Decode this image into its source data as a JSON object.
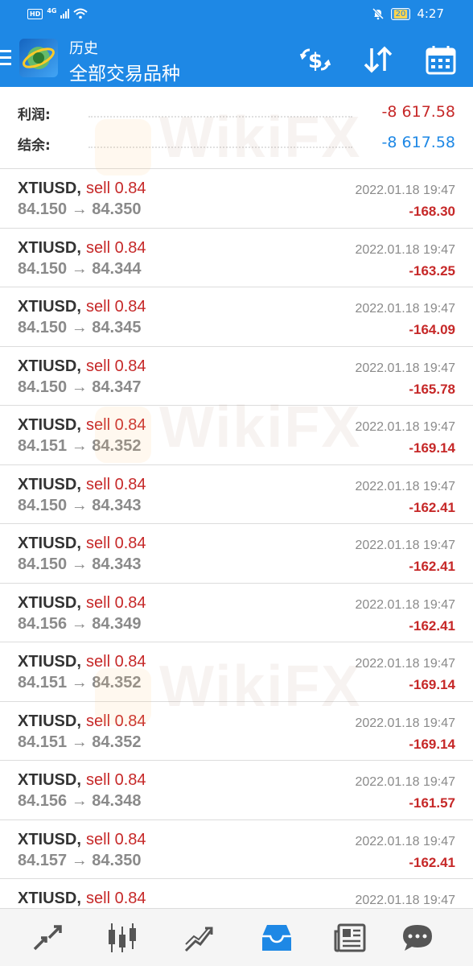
{
  "status_bar": {
    "hd": "HD",
    "network": "4G",
    "battery": "20",
    "time": "4:27"
  },
  "app_bar": {
    "title": "历史",
    "subtitle": "全部交易品种"
  },
  "summary": {
    "profit_label": "利润:",
    "profit_value": "-8 617.58",
    "balance_label": "结余:",
    "balance_value": "-8 617.58"
  },
  "trades": [
    {
      "symbol": "XTIUSD,",
      "side": "sell 0.84",
      "prices": "84.150 → 84.350",
      "time": "2022.01.18 19:47",
      "profit": "-168.30"
    },
    {
      "symbol": "XTIUSD,",
      "side": "sell 0.84",
      "prices": "84.150 → 84.344",
      "time": "2022.01.18 19:47",
      "profit": "-163.25"
    },
    {
      "symbol": "XTIUSD,",
      "side": "sell 0.84",
      "prices": "84.150 → 84.345",
      "time": "2022.01.18 19:47",
      "profit": "-164.09"
    },
    {
      "symbol": "XTIUSD,",
      "side": "sell 0.84",
      "prices": "84.150 → 84.347",
      "time": "2022.01.18 19:47",
      "profit": "-165.78"
    },
    {
      "symbol": "XTIUSD,",
      "side": "sell 0.84",
      "prices": "84.151 → 84.352",
      "time": "2022.01.18 19:47",
      "profit": "-169.14"
    },
    {
      "symbol": "XTIUSD,",
      "side": "sell 0.84",
      "prices": "84.150 → 84.343",
      "time": "2022.01.18 19:47",
      "profit": "-162.41"
    },
    {
      "symbol": "XTIUSD,",
      "side": "sell 0.84",
      "prices": "84.150 → 84.343",
      "time": "2022.01.18 19:47",
      "profit": "-162.41"
    },
    {
      "symbol": "XTIUSD,",
      "side": "sell 0.84",
      "prices": "84.156 → 84.349",
      "time": "2022.01.18 19:47",
      "profit": "-162.41"
    },
    {
      "symbol": "XTIUSD,",
      "side": "sell 0.84",
      "prices": "84.151 → 84.352",
      "time": "2022.01.18 19:47",
      "profit": "-169.14"
    },
    {
      "symbol": "XTIUSD,",
      "side": "sell 0.84",
      "prices": "84.151 → 84.352",
      "time": "2022.01.18 19:47",
      "profit": "-169.14"
    },
    {
      "symbol": "XTIUSD,",
      "side": "sell 0.84",
      "prices": "84.156 → 84.348",
      "time": "2022.01.18 19:47",
      "profit": "-161.57"
    },
    {
      "symbol": "XTIUSD,",
      "side": "sell 0.84",
      "prices": "84.157 → 84.350",
      "time": "2022.01.18 19:47",
      "profit": "-162.41"
    },
    {
      "symbol": "XTIUSD,",
      "side": "sell 0.84",
      "prices": "",
      "time": "2022.01.18 19:47",
      "profit": ""
    }
  ],
  "bottom_nav": [
    {
      "icon": "quotes-icon"
    },
    {
      "icon": "chart-icon"
    },
    {
      "icon": "trade-icon"
    },
    {
      "icon": "history-icon",
      "active": true
    },
    {
      "icon": "news-icon"
    },
    {
      "icon": "messages-icon"
    }
  ],
  "watermark": "WikiFX",
  "colors": {
    "app_bar": "#1e88e5",
    "loss": "#c62828",
    "balance": "#1e88e5",
    "active_nav": "#1e88e5",
    "nav_icon": "#555555"
  }
}
